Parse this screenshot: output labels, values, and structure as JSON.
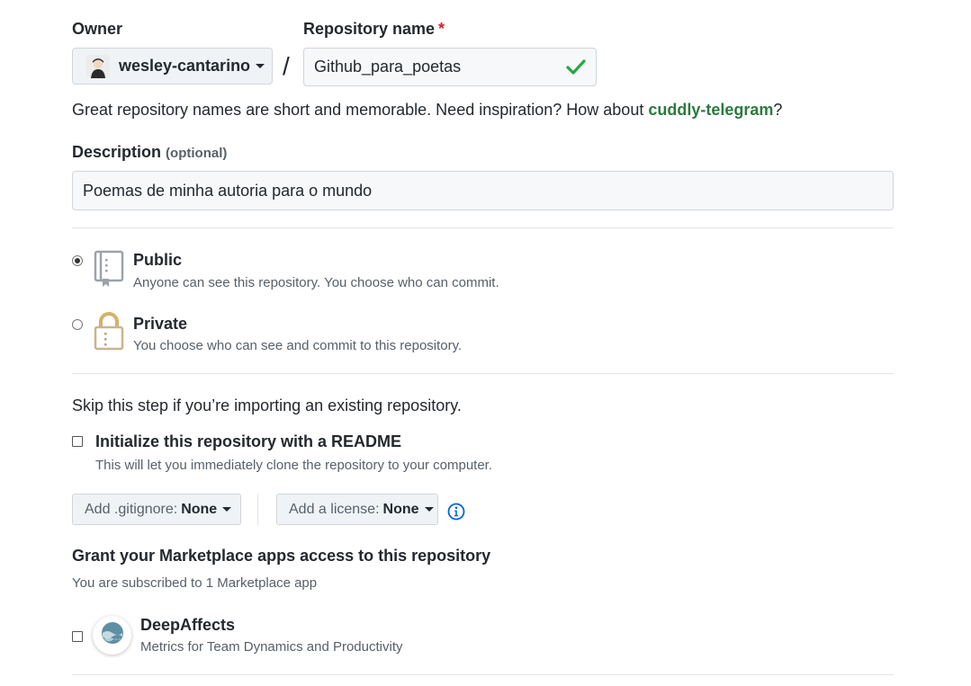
{
  "owner": {
    "label": "Owner",
    "value": "wesley-cantarino"
  },
  "repo_name": {
    "label": "Repository name",
    "required_marker": "*",
    "value": "Github_para_poetas",
    "separator": "/"
  },
  "suggestion": {
    "prefix": "Great repository names are short and memorable. Need inspiration? How about ",
    "name": "cuddly-telegram",
    "suffix": "?"
  },
  "description": {
    "label": "Description",
    "optional": "(optional)",
    "value": "Poemas de minha autoria para o mundo"
  },
  "visibility": {
    "public": {
      "title": "Public",
      "note": "Anyone can see this repository. You choose who can commit.",
      "selected": true
    },
    "private": {
      "title": "Private",
      "note": "You choose who can see and commit to this repository.",
      "selected": false
    }
  },
  "init": {
    "skip_text": "Skip this step if you’re importing an existing repository.",
    "readme_title": "Initialize this repository with a README",
    "readme_note": "This will let you immediately clone the repository to your computer.",
    "readme_checked": false
  },
  "gitignore": {
    "label": "Add .gitignore:",
    "value": "None"
  },
  "license": {
    "label": "Add a license:",
    "value": "None"
  },
  "marketplace": {
    "title": "Grant your Marketplace apps access to this repository",
    "subtitle": "You are subscribed to 1 Marketplace app",
    "apps": [
      {
        "name": "DeepAffects",
        "note": "Metrics for Team Dynamics and Productivity",
        "checked": false
      }
    ]
  },
  "colors": {
    "success": "#28a745",
    "info": "#0366d6",
    "required": "#cb2431"
  },
  "icons": {
    "valid": "check-icon",
    "public": "repo-book-icon",
    "private": "lock-icon",
    "info": "info-icon",
    "dropdown": "caret-down-icon"
  }
}
